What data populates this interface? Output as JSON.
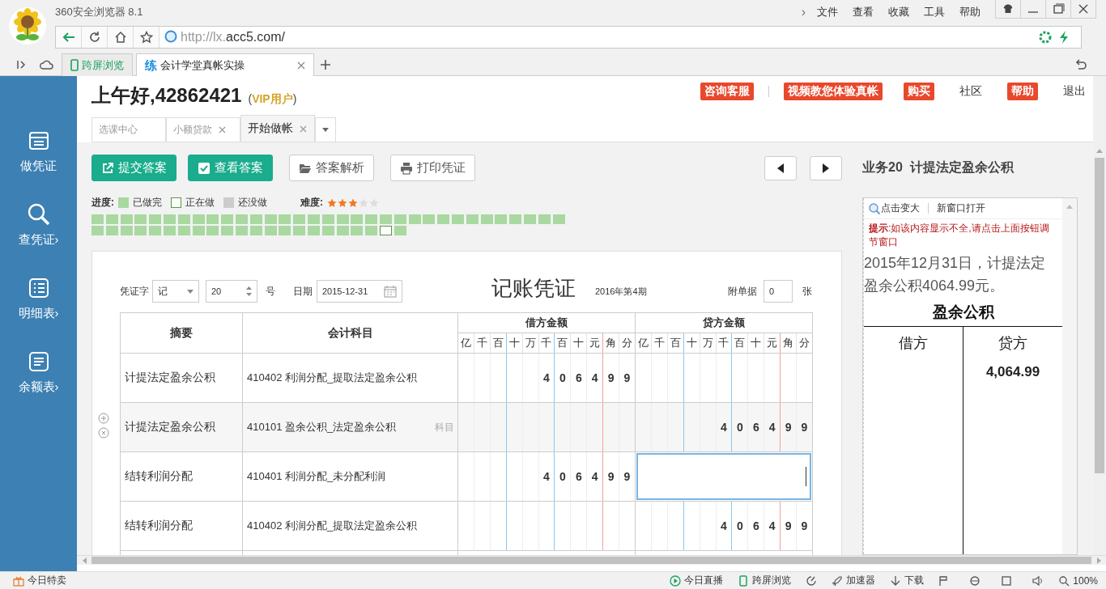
{
  "browser": {
    "title": "360安全浏览器 8.1",
    "more": "›",
    "menu": [
      "文件",
      "查看",
      "收藏",
      "工具",
      "帮助"
    ],
    "url_scheme": "http://lx.",
    "url_host": "acc5.com/",
    "tabs": [
      {
        "label": "跨屏浏览",
        "kind": "cross-screen",
        "selected": false
      },
      {
        "badge": "练",
        "label": "会计学堂真帐实操",
        "kind": "page",
        "selected": true
      }
    ]
  },
  "sidebar": {
    "items": [
      {
        "label": "做凭证",
        "kind": "voucher"
      },
      {
        "label": "查凭证›",
        "kind": "search"
      },
      {
        "label": "明细表›",
        "kind": "list"
      },
      {
        "label": "余额表›",
        "kind": "balance"
      }
    ]
  },
  "header": {
    "greeting": "上午好,42862421",
    "vip": "(**VIP用户**)",
    "links": [
      {
        "label": "咨询客服",
        "kind": "badge"
      },
      {
        "label": "视频教您体验真帐",
        "kind": "badge"
      },
      {
        "label": "购买",
        "kind": "badge"
      },
      {
        "label": "社区",
        "kind": "plain"
      },
      {
        "label": "帮助",
        "kind": "badge"
      },
      {
        "label": "退出",
        "kind": "plain"
      }
    ]
  },
  "page_tabs": [
    {
      "label": "选课中心",
      "selected": false,
      "closable": false
    },
    {
      "label": "小额贷款",
      "selected": false,
      "closable": true
    },
    {
      "label": "开始做帐",
      "selected": true,
      "closable": true
    }
  ],
  "toolbar": [
    {
      "label": "提交答案",
      "kind": "submit"
    },
    {
      "label": "查看答案",
      "kind": "answer"
    },
    {
      "label": "答案解析",
      "kind": "analysis"
    },
    {
      "label": "打印凭证",
      "kind": "print"
    }
  ],
  "progress": {
    "label": "进度:",
    "legend": [
      {
        "label": "已做完",
        "kind": "done"
      },
      {
        "label": "正在做",
        "kind": "current"
      },
      {
        "label": "还没做",
        "kind": "todo"
      }
    ],
    "difficulty_label": "难度:",
    "stars": 3,
    "squares": [
      {
        "kind": "done"
      },
      {
        "kind": "done"
      },
      {
        "kind": "done"
      },
      {
        "kind": "done"
      },
      {
        "kind": "done"
      },
      {
        "kind": "done"
      },
      {
        "kind": "done"
      },
      {
        "kind": "done"
      },
      {
        "kind": "done"
      },
      {
        "kind": "done"
      },
      {
        "kind": "done"
      },
      {
        "kind": "done"
      },
      {
        "kind": "done"
      },
      {
        "kind": "done"
      },
      {
        "kind": "done"
      },
      {
        "kind": "done"
      },
      {
        "kind": "done"
      },
      {
        "kind": "done"
      },
      {
        "kind": "done"
      },
      {
        "kind": "done"
      },
      {
        "kind": "done"
      },
      {
        "kind": "done"
      },
      {
        "kind": "done"
      },
      {
        "kind": "done"
      },
      {
        "kind": "done"
      },
      {
        "kind": "done"
      },
      {
        "kind": "done"
      },
      {
        "kind": "done"
      },
      {
        "kind": "done"
      },
      {
        "kind": "done"
      },
      {
        "kind": "done"
      },
      {
        "kind": "done"
      },
      {
        "kind": "done"
      },
      {
        "kind": "done"
      },
      {
        "kind": "done"
      },
      {
        "kind": "done"
      },
      {
        "kind": "done"
      },
      {
        "kind": "done"
      },
      {
        "kind": "done"
      },
      {
        "kind": "done"
      },
      {
        "kind": "done"
      },
      {
        "kind": "done"
      },
      {
        "kind": "done"
      },
      {
        "kind": "done"
      },
      {
        "kind": "done"
      },
      {
        "kind": "done"
      },
      {
        "kind": "done"
      },
      {
        "kind": "done"
      },
      {
        "kind": "done"
      },
      {
        "kind": "done"
      },
      {
        "kind": "done"
      },
      {
        "kind": "done"
      },
      {
        "kind": "done"
      },
      {
        "kind": "current"
      },
      {
        "kind": "done"
      }
    ]
  },
  "voucher": {
    "word_label": "凭证字",
    "word": "记",
    "number": "20",
    "number_suffix": "号",
    "date_label": "日期",
    "date": "2015-12-31",
    "title": "记账凭证",
    "period": "2016年第4期",
    "attach_label": "附单据",
    "attachments": "0",
    "attach_suffix": "张",
    "columns": [
      "摘要",
      "会计科目",
      "借方金额",
      "贷方金额"
    ],
    "debit_units": [
      "亿",
      "千",
      "百",
      "十",
      "万",
      "千",
      "百",
      "十",
      "元",
      "角",
      "分"
    ],
    "credit_units": [
      "亿",
      "千",
      "百",
      "十",
      "万",
      "千",
      "百",
      "十",
      "元",
      "角",
      "分"
    ],
    "rows": [
      {
        "summary": "计提法定盈余公积",
        "account": "410402 利润分配_提取法定盈余公积",
        "debit": [
          "4",
          "0",
          "6",
          "4",
          "9",
          "9"
        ],
        "hovered": false,
        "editing": false
      },
      {
        "summary": "计提法定盈余公积",
        "account": "410101 盈余公积_法定盈余公积",
        "hint": "科目",
        "credit": [
          "4",
          "0",
          "6",
          "4",
          "9",
          "9"
        ],
        "hovered": true,
        "editing": false
      },
      {
        "summary": "结转利润分配",
        "account": "410401 利润分配_未分配利润",
        "debit": [
          "4",
          "0",
          "6",
          "4",
          "9",
          "9"
        ],
        "hovered": false,
        "editing": true
      },
      {
        "summary": "结转利润分配",
        "account": "410402 利润分配_提取法定盈余公积",
        "credit": [
          "4",
          "0",
          "6",
          "4",
          "9",
          "9"
        ],
        "hovered": false,
        "editing": false
      }
    ]
  },
  "task": {
    "title": "业务20  计提法定盈余公积",
    "zoom": "点击变大",
    "new_window": "新窗口打开",
    "hint": "**提示**:如该内容显示不全,请点击上面按钮调节窗口",
    "description": "2015年12月31日，计提法定盈余公积4064.99元。",
    "account_title": "盈余公积",
    "debit_label": "借方",
    "credit_label": "贷方",
    "credit_value": "4,064.99"
  },
  "status_bar": {
    "left": "今日特卖",
    "items": [
      {
        "label": "今日直播",
        "kind": "live"
      },
      {
        "label": "跨屏浏览",
        "kind": "phone"
      },
      {
        "label": "加速器",
        "kind": "rocket"
      },
      {
        "label": "下载",
        "kind": "download"
      },
      {
        "label": "100%",
        "kind": "zoom"
      }
    ]
  }
}
